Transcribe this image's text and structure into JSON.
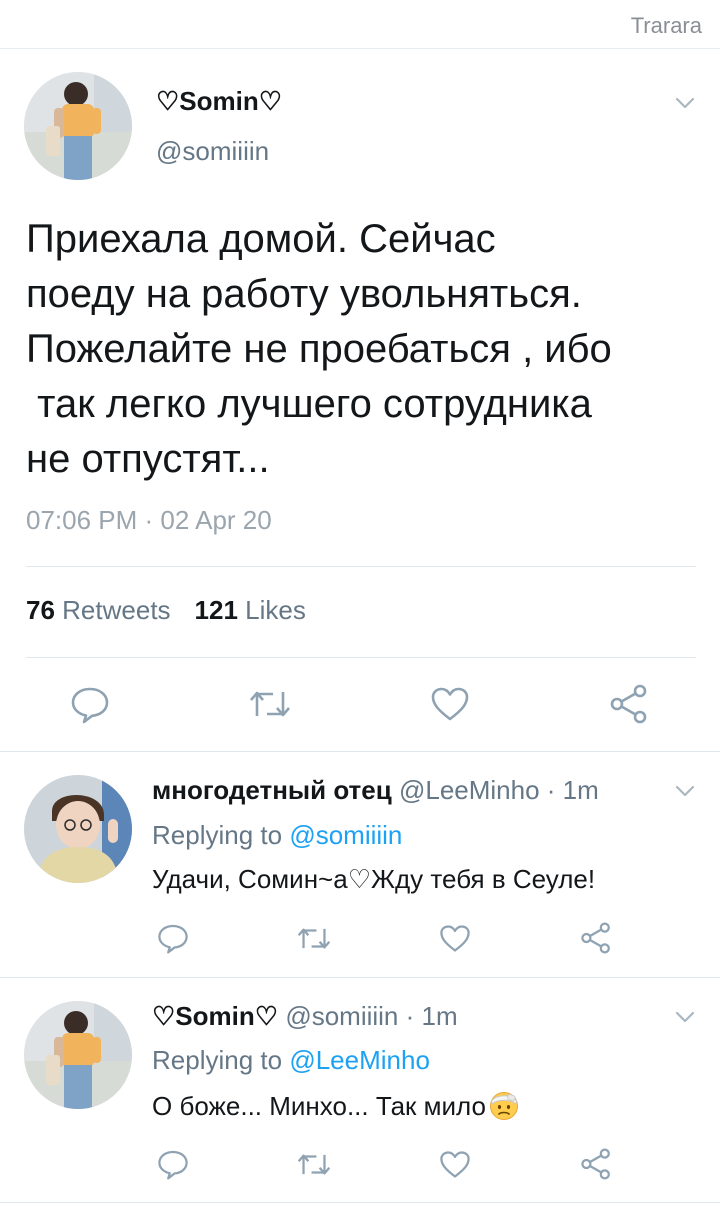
{
  "topbar": {
    "label": "Trarara"
  },
  "main_tweet": {
    "display_name": "♡Somin♡",
    "handle": "@somiiiin",
    "text": "Приехала домой. Сейчас\nпоеду на работу увольняться.\nПожелайте не проебаться , ибо\n так легко лучшего сотрудника\nне отпустят...",
    "timestamp": "07:06 PM · 02 Apr 20",
    "retweets_count": "76",
    "retweets_label": "Retweets",
    "likes_count": "121",
    "likes_label": "Likes"
  },
  "replies": [
    {
      "display_name": "многодетный отец",
      "handle": "@LeeMinho",
      "time": "· 1m",
      "replying_prefix": "Replying to",
      "replying_to": "@somiiiin",
      "text": "Удачи, Сомин~а♡Жду тебя в Сеуле!"
    },
    {
      "display_name": "♡Somin♡",
      "handle": "@somiiiin",
      "time": "· 1m",
      "replying_prefix": "Replying to",
      "replying_to": "@LeeMinho",
      "text": "О боже... Минхо... Так мило",
      "emoji": "face-with-head-bandage"
    }
  ],
  "icons": {
    "reply": "speech-bubble-icon",
    "retweet": "retweet-arrows-icon",
    "like": "heart-icon",
    "share": "share-nodes-icon",
    "menu": "chevron-down-icon"
  },
  "colors": {
    "text": "#14171a",
    "secondary": "#657786",
    "link": "#1da1f2",
    "icon": "#8fa2b2",
    "divider": "#e1e8ed"
  }
}
